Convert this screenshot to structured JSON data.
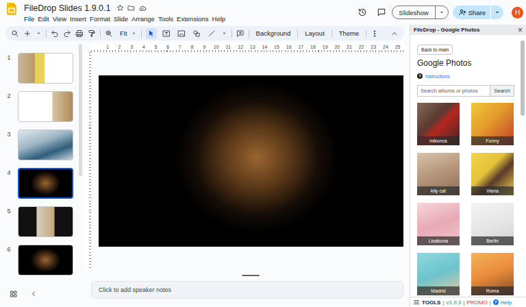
{
  "app": {
    "title": "FileDrop Slides 1.9.0.1",
    "menu": [
      "File",
      "Edit",
      "View",
      "Insert",
      "Format",
      "Slide",
      "Arrange",
      "Tools",
      "Extensions",
      "Help"
    ],
    "slideshow": "Slideshow",
    "share": "Share",
    "avatar": "H"
  },
  "toolbar": {
    "zoom": "Fit",
    "tools": [
      {
        "selected": true
      },
      {
        "selected": false
      },
      {
        "selected": false
      },
      {
        "selected": false
      },
      {
        "selected": false
      }
    ],
    "buttons": [
      "Background",
      "Layout",
      "Theme"
    ]
  },
  "ruler": {
    "ticks": [
      "1",
      "2",
      "3",
      "4",
      "5",
      "6",
      "7",
      "8",
      "9",
      "10",
      "11",
      "12",
      "13",
      "14",
      "15",
      "16",
      "17",
      "18",
      "19",
      "20",
      "21",
      "22",
      "23",
      "24",
      "25"
    ]
  },
  "filmstrip": {
    "slides": [
      {
        "number": "1",
        "selected": false
      },
      {
        "number": "2",
        "selected": false
      },
      {
        "number": "3",
        "selected": false
      },
      {
        "number": "4",
        "selected": true
      },
      {
        "number": "5",
        "selected": false
      },
      {
        "number": "6",
        "selected": false
      }
    ]
  },
  "notes": {
    "placeholder": "Click to add speaker notes"
  },
  "panel": {
    "title": "FileDrop - Google Photos",
    "close": "×",
    "back": "Back to main",
    "heading": "Google Photos",
    "instructions_icon": "?",
    "instructions": "Instructions",
    "search": {
      "placeholder": "Search albums or photos",
      "button": "Search"
    },
    "albums": [
      {
        "name": "mikonos"
      },
      {
        "name": "Funny"
      },
      {
        "name": "kity cat"
      },
      {
        "name": "Viena"
      },
      {
        "name": "Lisabona"
      },
      {
        "name": "Berlin"
      },
      {
        "name": "Madrid"
      },
      {
        "name": "Roma"
      }
    ],
    "footer": {
      "tools": "TOOLS",
      "separator": "|",
      "version": "v1.9.3",
      "promo": "PROMO",
      "help_icon": "?",
      "help": "Help"
    }
  }
}
